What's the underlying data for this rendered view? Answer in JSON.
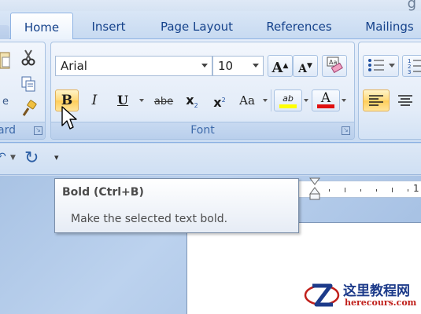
{
  "title_bar": {
    "glyph": "g"
  },
  "tabs": [
    {
      "label": "Home",
      "active": true
    },
    {
      "label": "Insert",
      "active": false
    },
    {
      "label": "Page Layout",
      "active": false
    },
    {
      "label": "References",
      "active": false
    },
    {
      "label": "Mailings",
      "active": false
    }
  ],
  "clipboard_group": {
    "label": "ard"
  },
  "font_group": {
    "label": "Font",
    "font_name": "Arial",
    "font_size": "10",
    "grow_font": "A",
    "shrink_font": "A",
    "bold": "B",
    "italic": "I",
    "underline": "U",
    "strikethrough": "abe",
    "subscript": "x",
    "subscript_mark": "2",
    "superscript": "x",
    "superscript_mark": "2",
    "change_case": "Aa",
    "highlight_glyph": "ab",
    "font_color_glyph": "A",
    "highlight_color": "#ffff00",
    "font_color": "#e01010"
  },
  "tooltip": {
    "title": "Bold (Ctrl+B)",
    "description": "Make the selected text bold."
  },
  "ruler": {
    "number": "1"
  },
  "watermark": {
    "title": "这里教程网",
    "url": "herecours.com"
  },
  "colors": {
    "ribbon_text": "#15428b",
    "accent_border": "#8db2e3",
    "hover": "#ffd979"
  }
}
